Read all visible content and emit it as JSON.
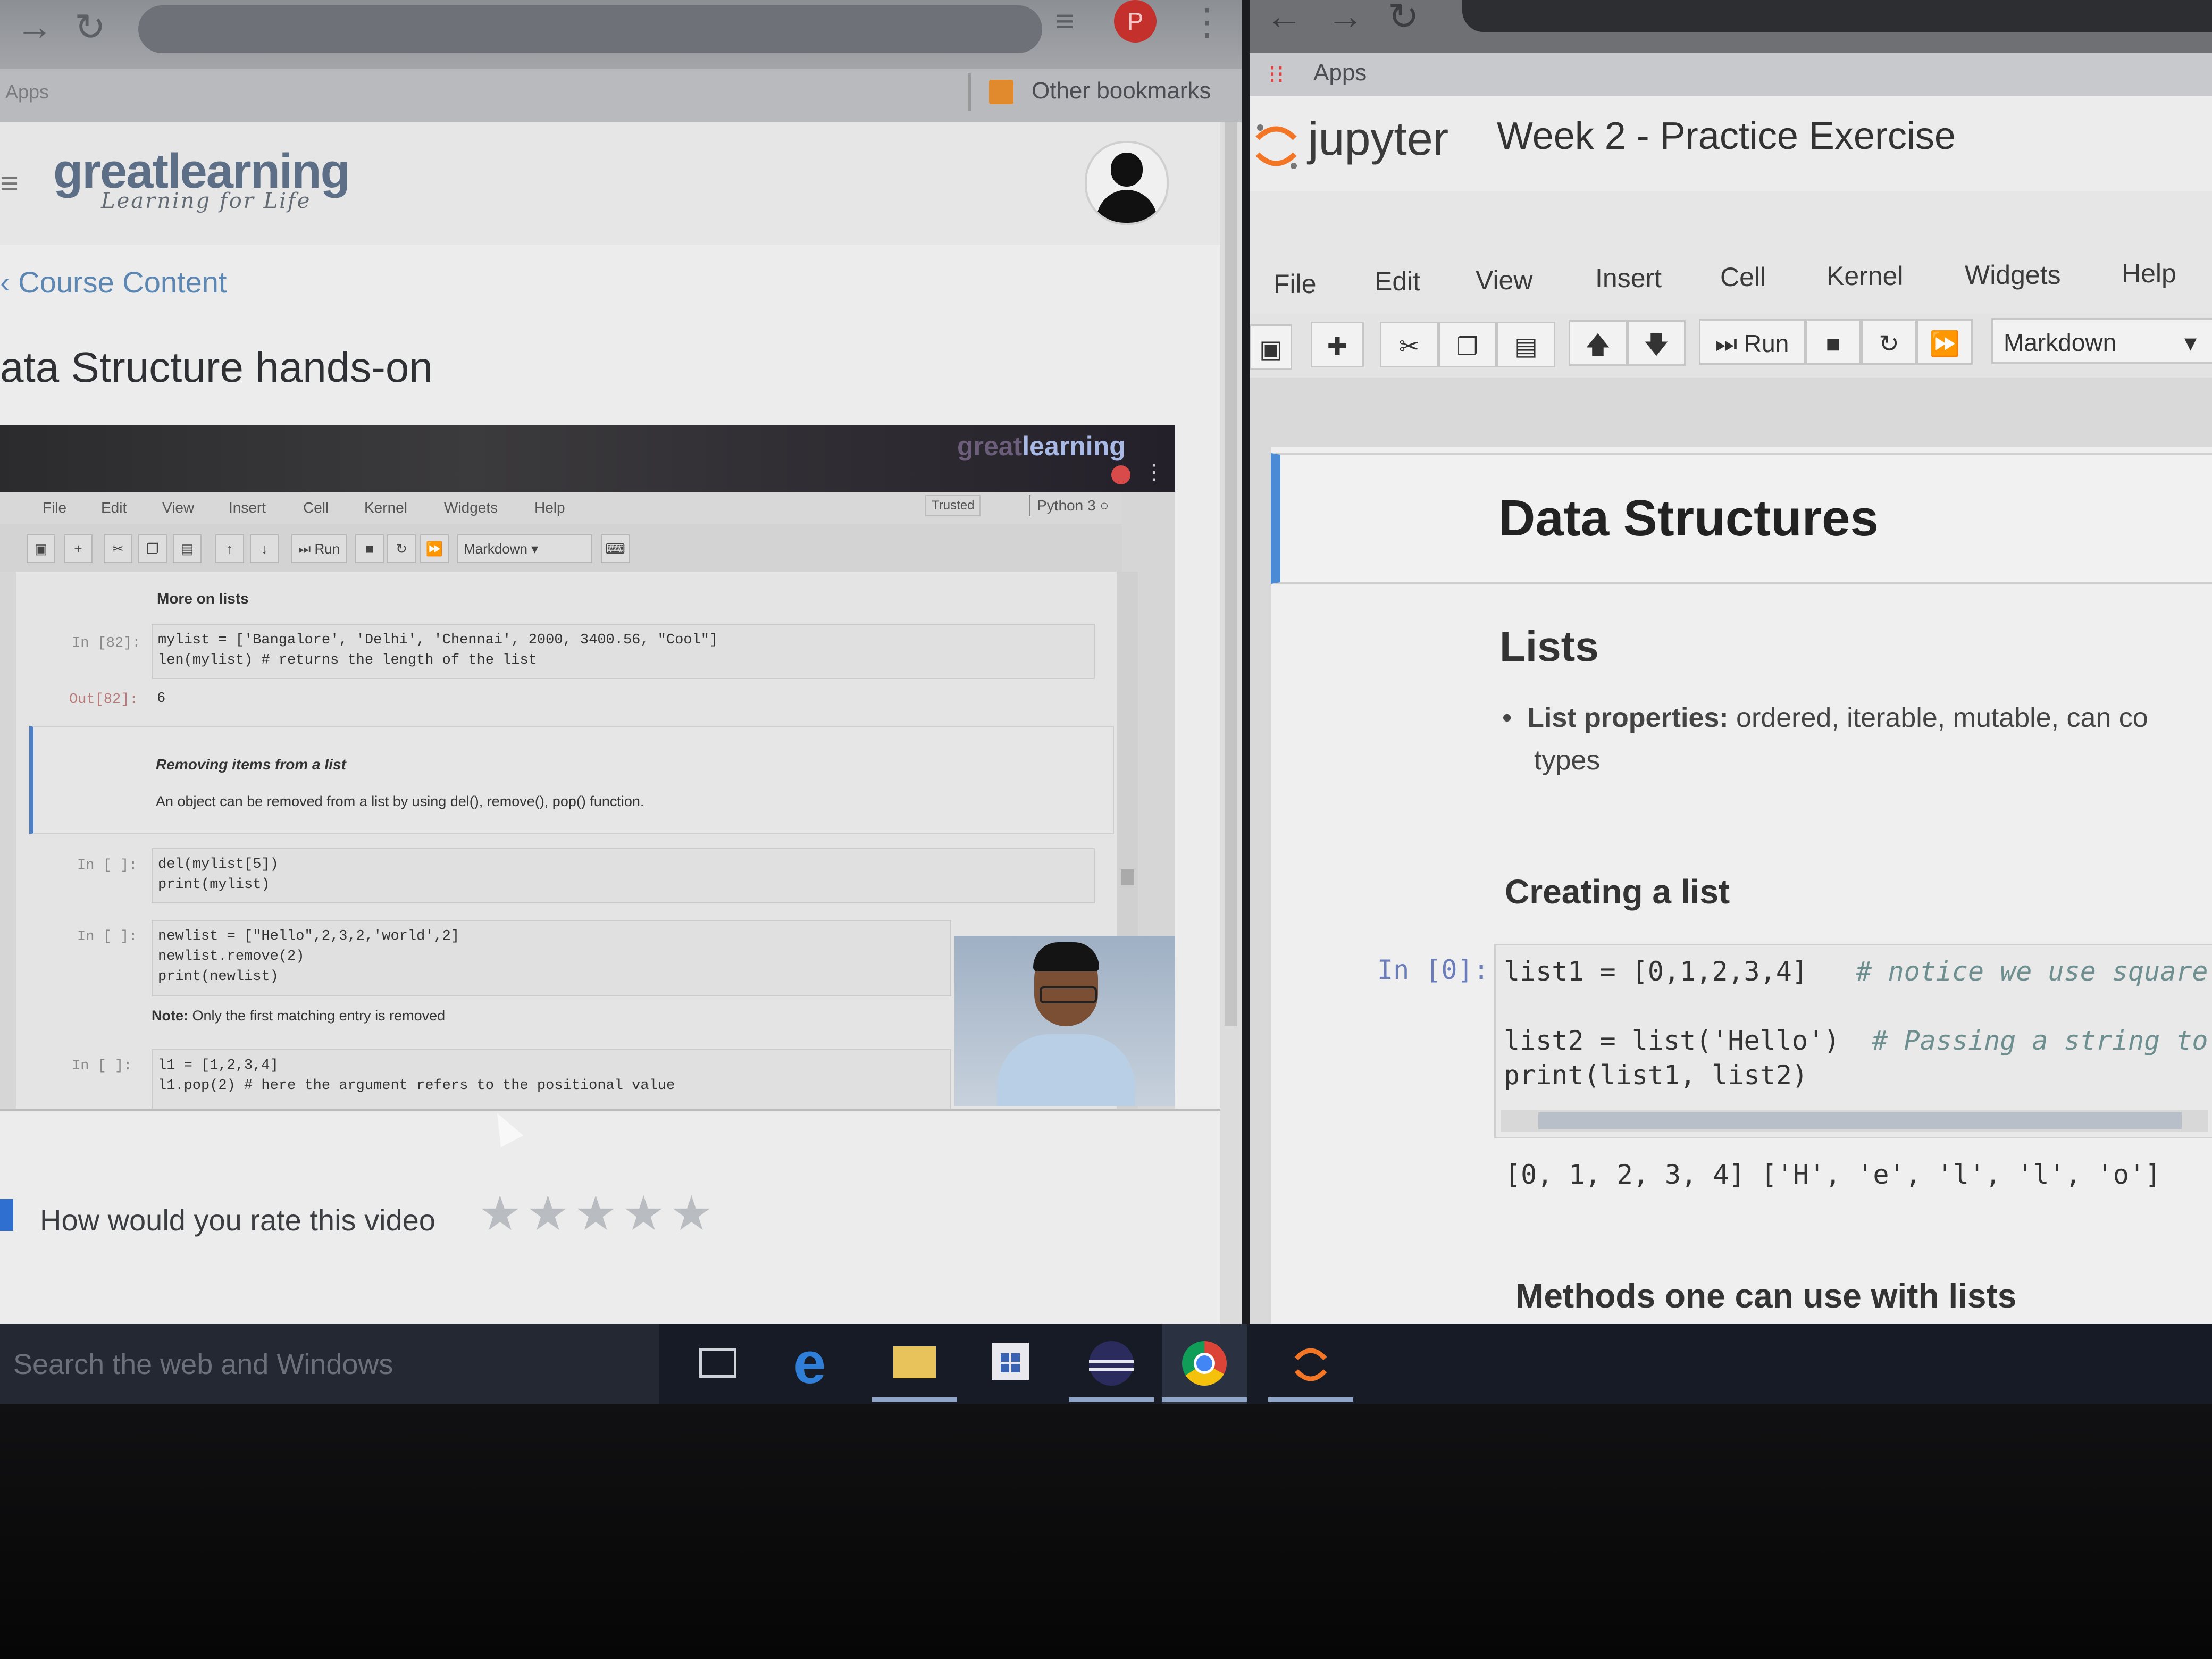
{
  "left_browser": {
    "bookmarks": {
      "apps": "Apps",
      "other": "Other bookmarks"
    },
    "profile_initial": "P",
    "site": {
      "logo": "greatlearning",
      "tagline": "Learning for Life"
    },
    "breadcrumb": "Course Content",
    "lesson_title": "ata Structure hands-on",
    "video": {
      "brand_a": "great",
      "brand_b": "learning",
      "menu": [
        "File",
        "Edit",
        "View",
        "Insert",
        "Cell",
        "Kernel",
        "Widgets",
        "Help"
      ],
      "trusted": "Trusted",
      "kernel": "Python 3",
      "run_label": "Run",
      "cell_type": "Markdown",
      "cells": {
        "heading1": "More on lists",
        "prompt1": "In [82]:",
        "code1a": "mylist = ['Bangalore', 'Delhi', 'Chennai', 2000, 3400.56, \"Cool\"]",
        "code1b": "len(mylist) # returns the length of the list",
        "out_prompt": "Out[82]:",
        "out_value": "6",
        "md_title": "Removing items from a list",
        "md_text": "An object can be removed from a list by using del(), remove(), pop() function.",
        "prompt2": "In [ ]:",
        "code2a": "del(mylist[5])",
        "code2b": "print(mylist)",
        "prompt3": "In [ ]:",
        "code3a": "newlist = [\"Hello\",2,3,2,'world',2]",
        "code3b": "newlist.remove(2)",
        "code3c": "print(newlist)",
        "note_bold": "Note:",
        "note_text": " Only the first matching entry is removed",
        "prompt4": "In [ ]:",
        "code4a": "l1 = [1,2,3,4]",
        "code4b": "l1.pop(2) # here the argument refers to the positional value"
      }
    },
    "rating_prompt": "How would you rate this video",
    "stars": [
      "★",
      "★",
      "★",
      "★",
      "★"
    ]
  },
  "right_browser": {
    "bookmarks": {
      "apps": "Apps"
    },
    "jupyter_word": "jupyter",
    "notebook_title": "Week 2 - Practice Exercise",
    "menu": [
      "File",
      "Edit",
      "View",
      "Insert",
      "Cell",
      "Kernel",
      "Widgets",
      "Help"
    ],
    "toolbar": {
      "run_label": "Run",
      "cell_type": "Markdown"
    },
    "notebook": {
      "h1": "Data Structures",
      "h2": "Lists",
      "bullet_bold": "List properties:",
      "bullet_text": " ordered, iterable, mutable, can co",
      "bullet_cont": "types",
      "h3a": "Creating a list",
      "prompt": "In [0]:",
      "code1": "list1 = [0,1,2,3,4]",
      "comment1": "# notice we use square",
      "code2": "list2 = list('Hello')",
      "comment2": "# Passing a string to",
      "code3": "print(list1, list2)",
      "output": "[0, 1, 2, 3, 4] ['H', 'e', 'l', 'l', 'o']",
      "h3b": "Methods one can use with lists"
    }
  },
  "taskbar": {
    "search_placeholder": "Search the web and Windows",
    "icons": [
      "task-view-icon",
      "edge-icon",
      "file-explorer-icon",
      "store-icon",
      "eclipse-icon",
      "chrome-icon",
      "jupyter-icon"
    ]
  },
  "colors": {
    "accent_blue": "#2f7fd8",
    "greatlearning_orange": "#e57d2a",
    "jupyter_orange": "#f37626"
  }
}
